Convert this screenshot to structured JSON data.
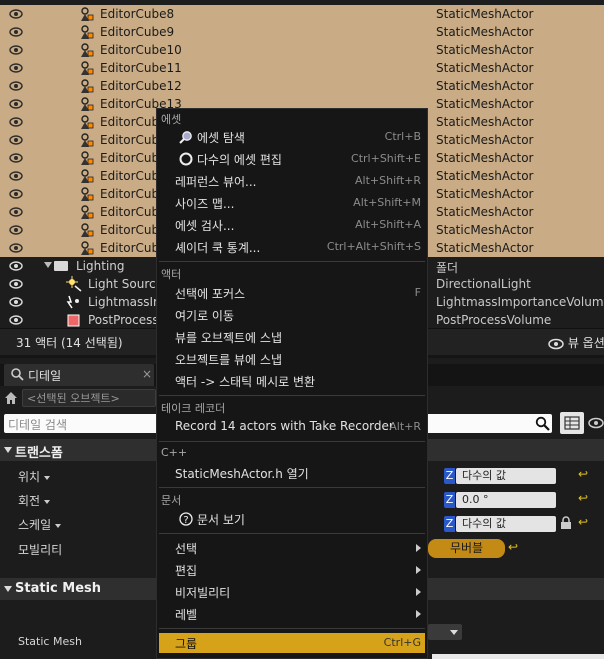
{
  "outliner": {
    "rows": [
      {
        "name": "EditorCube8",
        "type": "StaticMeshActor",
        "selected": true
      },
      {
        "name": "EditorCube9",
        "type": "StaticMeshActor",
        "selected": true
      },
      {
        "name": "EditorCube10",
        "type": "StaticMeshActor",
        "selected": true
      },
      {
        "name": "EditorCube11",
        "type": "StaticMeshActor",
        "selected": true
      },
      {
        "name": "EditorCube12",
        "type": "StaticMeshActor",
        "selected": true
      },
      {
        "name": "EditorCube13",
        "type": "StaticMeshActor",
        "selected": true
      },
      {
        "name": "EditorCube",
        "type": "StaticMeshActor",
        "selected": true
      },
      {
        "name": "EditorCube",
        "type": "StaticMeshActor",
        "selected": true
      },
      {
        "name": "EditorCube",
        "type": "StaticMeshActor",
        "selected": true
      },
      {
        "name": "EditorCube",
        "type": "StaticMeshActor",
        "selected": true
      },
      {
        "name": "EditorCube",
        "type": "StaticMeshActor",
        "selected": true
      },
      {
        "name": "EditorCube",
        "type": "StaticMeshActor",
        "selected": true
      },
      {
        "name": "EditorCube",
        "type": "StaticMeshActor",
        "selected": true
      },
      {
        "name": "EditorCube",
        "type": "StaticMeshActor",
        "selected": true
      },
      {
        "name": "Lighting",
        "type": "폴더",
        "selected": false
      },
      {
        "name": "Light Source",
        "type": "DirectionalLight",
        "selected": false
      },
      {
        "name": "LightmassIm",
        "type": "LightmassImportanceVolume",
        "selected": false
      },
      {
        "name": "PostProcess",
        "type": "PostProcessVolume",
        "selected": false
      }
    ]
  },
  "statusbar": {
    "actor_count": "31 액터 (14 선택됨)",
    "view_options": "뷰 옵션"
  },
  "details": {
    "tab_label": "디테일",
    "tab_close": "×",
    "selected_objects": "<선택된 오브젝트>",
    "search_placeholder": "디테일 검색",
    "transform_header": "트랜스폼",
    "location_label": "위치",
    "rotation_label": "회전",
    "scale_label": "스케일",
    "mobility_label": "모빌리티",
    "axis_z": "Z",
    "location_z": "다수의 값",
    "rotation_z": "0.0 °",
    "scale_z": "다수의 값",
    "mobility_value": "무버블",
    "static_mesh_header": "Static Mesh",
    "static_mesh_label": "Static Mesh"
  },
  "context_menu": {
    "sections": {
      "asset": "에셋",
      "actor": "액터",
      "take_recorder": "테이크 레코더",
      "cpp": "C++",
      "docs": "문서"
    },
    "items": {
      "asset_browse": {
        "label": "에셋 탐색",
        "shortcut": "Ctrl+B"
      },
      "multi_edit": {
        "label": "다수의 에셋 편집",
        "shortcut": "Ctrl+Shift+E"
      },
      "ref_viewer": {
        "label": "레퍼런스 뷰어...",
        "shortcut": "Alt+Shift+R"
      },
      "size_map": {
        "label": "사이즈 맵...",
        "shortcut": "Alt+Shift+M"
      },
      "asset_audit": {
        "label": "에셋 검사...",
        "shortcut": "Alt+Shift+A"
      },
      "shader_stats": {
        "label": "셰이더 쿡 통계...",
        "shortcut": "Ctrl+Alt+Shift+S"
      },
      "focus_sel": {
        "label": "선택에 포커스",
        "shortcut": "F"
      },
      "move_here": {
        "label": "여기로 이동",
        "shortcut": ""
      },
      "snap_view_obj": {
        "label": "뷰를 오브젝트에 스냅",
        "shortcut": ""
      },
      "snap_obj_view": {
        "label": "오브젝트를 뷰에 스냅",
        "shortcut": ""
      },
      "convert_mesh": {
        "label": "액터 -> 스태틱 메시로 변환",
        "shortcut": ""
      },
      "record": {
        "label": "Record 14 actors with Take Recorder",
        "shortcut": "Alt+R"
      },
      "open_header": {
        "label": "StaticMeshActor.h 열기",
        "shortcut": ""
      },
      "view_docs": {
        "label": "문서 보기",
        "shortcut": ""
      },
      "select": {
        "label": "선택"
      },
      "edit": {
        "label": "편집"
      },
      "visibility": {
        "label": "비저빌리티"
      },
      "level": {
        "label": "레벨"
      },
      "group": {
        "label": "그룹",
        "shortcut": "Ctrl+G"
      }
    }
  }
}
